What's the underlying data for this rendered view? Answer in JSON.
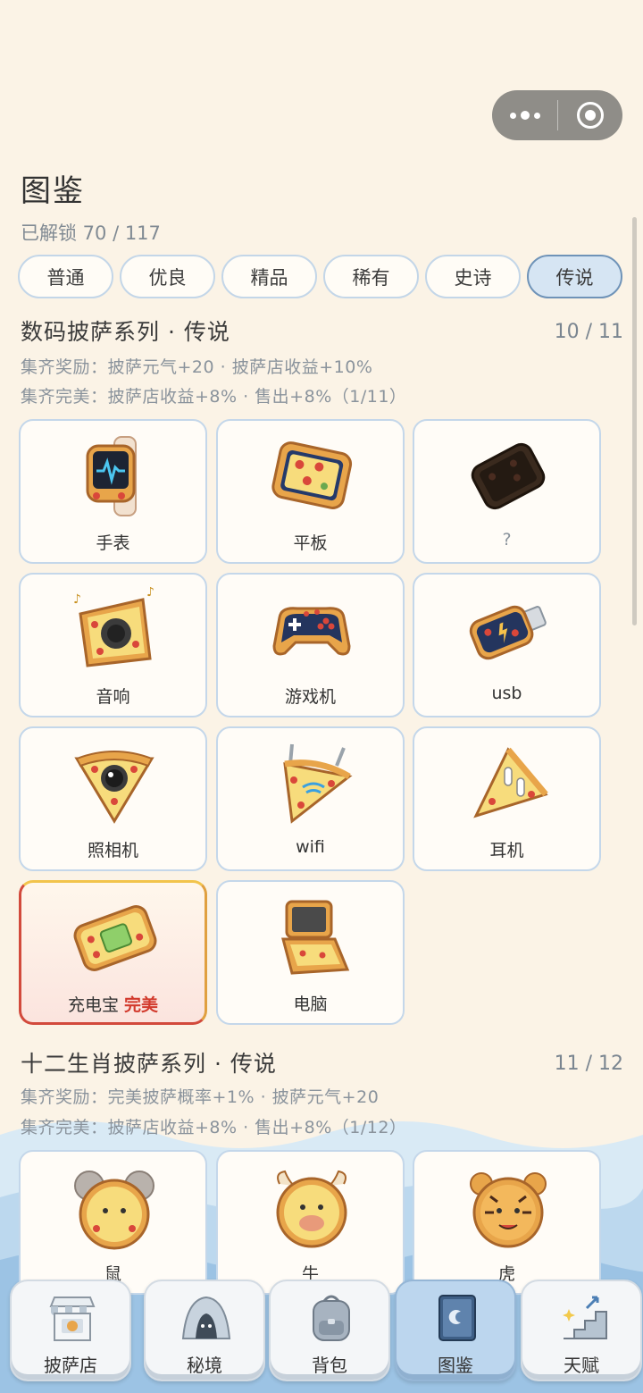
{
  "header": {
    "title": "图鉴",
    "unlock_status": "已解锁 70 / 117"
  },
  "tabs": [
    {
      "label": "普通",
      "active": false
    },
    {
      "label": "优良",
      "active": false
    },
    {
      "label": "精品",
      "active": false
    },
    {
      "label": "稀有",
      "active": false
    },
    {
      "label": "史诗",
      "active": false
    },
    {
      "label": "传说",
      "active": true
    }
  ],
  "sections": [
    {
      "title": "数码披萨系列 · 传说",
      "count": "10 / 11",
      "reward": "集齐奖励：披萨元气+20 · 披萨店收益+10%",
      "perfect": "集齐完美：披萨店收益+8% · 售出+8%（1/11）",
      "items": [
        {
          "label": "手表",
          "icon": "pizza-watch-icon"
        },
        {
          "label": "平板",
          "icon": "pizza-tablet-icon"
        },
        {
          "label": "?",
          "icon": "locked-phone-icon"
        },
        {
          "label": "音响",
          "icon": "pizza-speaker-icon"
        },
        {
          "label": "游戏机",
          "icon": "pizza-gamepad-icon"
        },
        {
          "label": "usb",
          "icon": "pizza-usb-icon"
        },
        {
          "label": "照相机",
          "icon": "pizza-camera-icon"
        },
        {
          "label": "wifi",
          "icon": "pizza-wifi-icon"
        },
        {
          "label": "耳机",
          "icon": "pizza-earbuds-icon"
        },
        {
          "label": "充电宝",
          "icon": "pizza-powerbank-icon",
          "tag": "完美"
        },
        {
          "label": "电脑",
          "icon": "pizza-laptop-icon"
        }
      ]
    },
    {
      "title": "十二生肖披萨系列 · 传说",
      "count": "11 / 12",
      "reward": "集齐奖励：完美披萨概率+1% · 披萨元气+20",
      "perfect": "集齐完美：披萨店收益+8% · 售出+8%（1/12）",
      "items": [
        {
          "label": "鼠",
          "icon": "pizza-rat-icon"
        },
        {
          "label": "牛",
          "icon": "pizza-ox-icon"
        },
        {
          "label": "虎",
          "icon": "pizza-tiger-icon"
        }
      ]
    }
  ],
  "nav": [
    {
      "label": "披萨店",
      "icon": "pizza-shop-icon",
      "active": false
    },
    {
      "label": "秘境",
      "icon": "cave-icon",
      "active": false
    },
    {
      "label": "背包",
      "icon": "backpack-icon",
      "active": false
    },
    {
      "label": "图鉴",
      "icon": "book-icon",
      "active": true
    },
    {
      "label": "天赋",
      "icon": "stairs-icon",
      "active": false
    }
  ],
  "colors": {
    "background": "#fbf3e6",
    "tab_border": "#c3d6e8",
    "tab_active_bg": "#d6e5f3",
    "perfect_tag": "#d23a2c",
    "crust": "#e8a54a",
    "cheese": "#f7dc7c",
    "pepperoni": "#d9473a"
  }
}
